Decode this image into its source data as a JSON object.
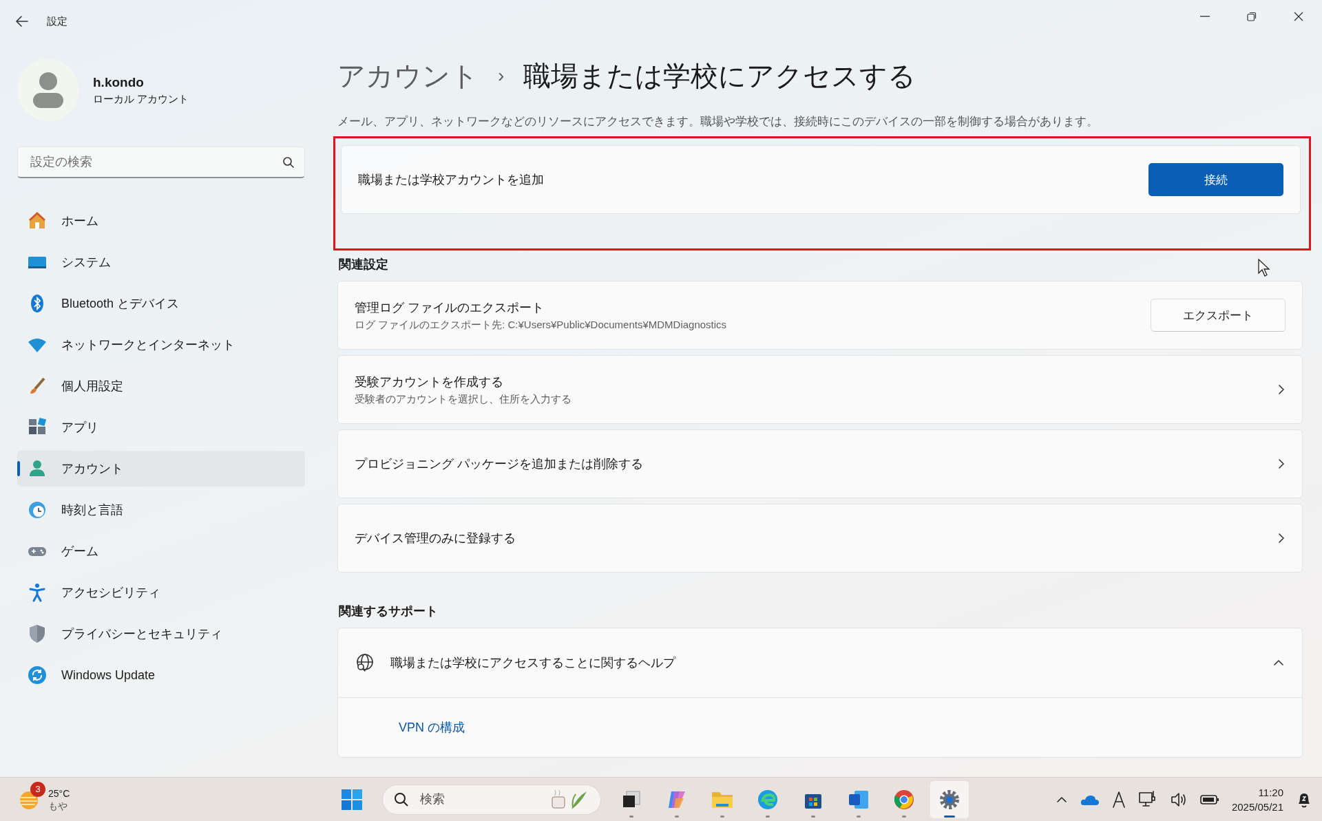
{
  "window": {
    "title": "設定"
  },
  "profile": {
    "name": "h.kondo",
    "type": "ローカル アカウント"
  },
  "search": {
    "placeholder": "設定の検索"
  },
  "nav": [
    {
      "label": "ホーム",
      "selected": false
    },
    {
      "label": "システム",
      "selected": false
    },
    {
      "label": "Bluetooth とデバイス",
      "selected": false
    },
    {
      "label": "ネットワークとインターネット",
      "selected": false
    },
    {
      "label": "個人用設定",
      "selected": false
    },
    {
      "label": "アプリ",
      "selected": false
    },
    {
      "label": "アカウント",
      "selected": true
    },
    {
      "label": "時刻と言語",
      "selected": false
    },
    {
      "label": "ゲーム",
      "selected": false
    },
    {
      "label": "アクセシビリティ",
      "selected": false
    },
    {
      "label": "プライバシーとセキュリティ",
      "selected": false
    },
    {
      "label": "Windows Update",
      "selected": false
    }
  ],
  "breadcrumb": {
    "parent": "アカウント",
    "separator": "›",
    "current": "職場または学校にアクセスする"
  },
  "description": "メール、アプリ、ネットワークなどのリソースにアクセスできます。職場や学校では、接続時にこのデバイスの一部を制御する場合があります。",
  "add_account": {
    "label": "職場または学校アカウントを追加",
    "button": "接続",
    "highlighted": true
  },
  "related_settings": {
    "title": "関連設定",
    "cards": [
      {
        "kind": "button",
        "title": "管理ログ ファイルのエクスポート",
        "subtitle": "ログ ファイルのエクスポート先: C:¥Users¥Public¥Documents¥MDMDiagnostics",
        "button": "エクスポート"
      },
      {
        "kind": "link",
        "title": "受験アカウントを作成する",
        "subtitle": "受験者のアカウントを選択し、住所を入力する"
      },
      {
        "kind": "link",
        "title": "プロビジョニング パッケージを追加または削除する"
      },
      {
        "kind": "link",
        "title": "デバイス管理のみに登録する"
      }
    ]
  },
  "related_support": {
    "title": "関連するサポート",
    "help": {
      "title": "職場または学校にアクセスすることに関するヘルプ",
      "expanded": true,
      "links": [
        "VPN の構成"
      ]
    }
  },
  "taskbar": {
    "weather": {
      "badge": "3",
      "temperature": "25°C",
      "condition": "もや"
    },
    "search_placeholder": "検索",
    "apps": [
      {
        "selected": false
      },
      {
        "selected": false
      },
      {
        "selected": false
      },
      {
        "selected": false
      },
      {
        "selected": false
      },
      {
        "selected": false
      },
      {
        "selected": false
      },
      {
        "selected": true
      }
    ],
    "time": "11:20",
    "date": "2025/05/21"
  }
}
